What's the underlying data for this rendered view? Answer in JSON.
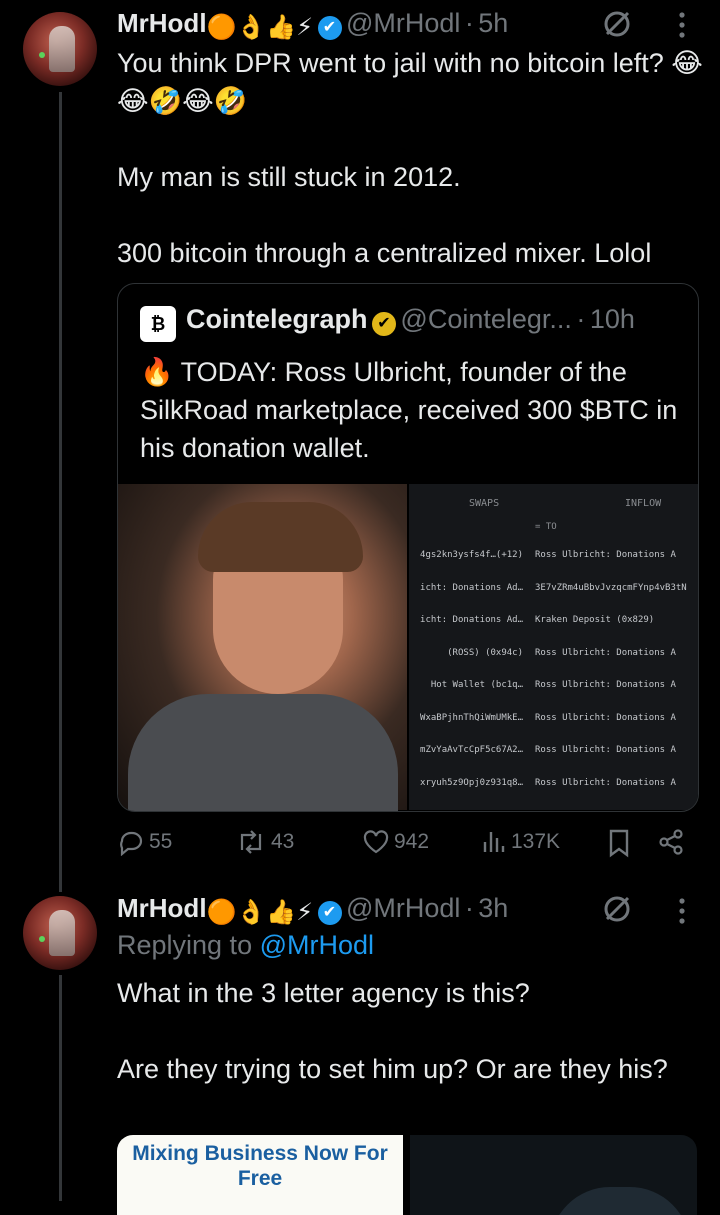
{
  "tweet1": {
    "author_name": "MrHodl",
    "author_emojis": "🟠👌👍⚡",
    "handle": "@MrHodl",
    "sep": "·",
    "time": "5h",
    "text": "You think DPR went to jail with no bitcoin left? 😂😂🤣😂🤣\n\nMy man is still stuck in 2012.\n\n300 bitcoin through a centralized mixer. Lolol"
  },
  "quote": {
    "author_name": "Cointelegraph",
    "handle": "@Cointelegr...",
    "sep": "·",
    "time": "10h",
    "text": "🔥 TODAY: Ross Ulbricht, founder of the SilkRoad marketplace, received 300 $BTC in his donation wallet.",
    "media_table": {
      "col_swaps": "SWAPS",
      "col_inflow": "INFLOW",
      "to_label": "= TO",
      "rows": [
        {
          "left": "4gs2kn3ysfs4f…(+12)",
          "right": "Ross Ulbricht: Donations A"
        },
        {
          "left": "icht: Donations Ad…",
          "right": "3E7vZRm4uBbvJvzqcmFYnp4vB3tN"
        },
        {
          "left": "icht: Donations Ad…",
          "right": "Kraken Deposit (0x829)"
        },
        {
          "left": "(ROSS) (0x94c)",
          "right": "Ross Ulbricht: Donations A"
        },
        {
          "left": "Hot Wallet (bc1q…",
          "right": "Ross Ulbricht: Donations A"
        },
        {
          "left": "WxaBPjhnThQiWmUMkE…",
          "right": "Ross Ulbricht: Donations A"
        },
        {
          "left": "mZvYaAvTcCpF5c67A2…",
          "right": "Ross Ulbricht: Donations A"
        },
        {
          "left": "xryuh5z9Opj0z931q8…",
          "right": "Ross Ulbricht: Donations A"
        }
      ]
    }
  },
  "actions": {
    "replies": "55",
    "reposts": "43",
    "likes": "942",
    "views": "137K"
  },
  "tweet2": {
    "author_name": "MrHodl",
    "author_emojis": "🟠👌👍⚡",
    "handle": "@MrHodl",
    "sep": "·",
    "time": "3h",
    "replying_prefix": "Replying to",
    "replying_handle": "@MrHodl",
    "text": "What in the 3 letter agency is this?\n\nAre they trying to set him up? Or are they his?",
    "ad_text": "Mixing Business Now For Free"
  },
  "colors": {
    "background": "#000000",
    "text": "#e7e9ea",
    "muted": "#71767b",
    "link": "#1d9bf0"
  },
  "icons": [
    "grok-icon",
    "more-icon",
    "reply-icon",
    "repost-icon",
    "like-icon",
    "views-icon",
    "bookmark-icon",
    "share-icon",
    "verified-icon",
    "fire-icon"
  ]
}
